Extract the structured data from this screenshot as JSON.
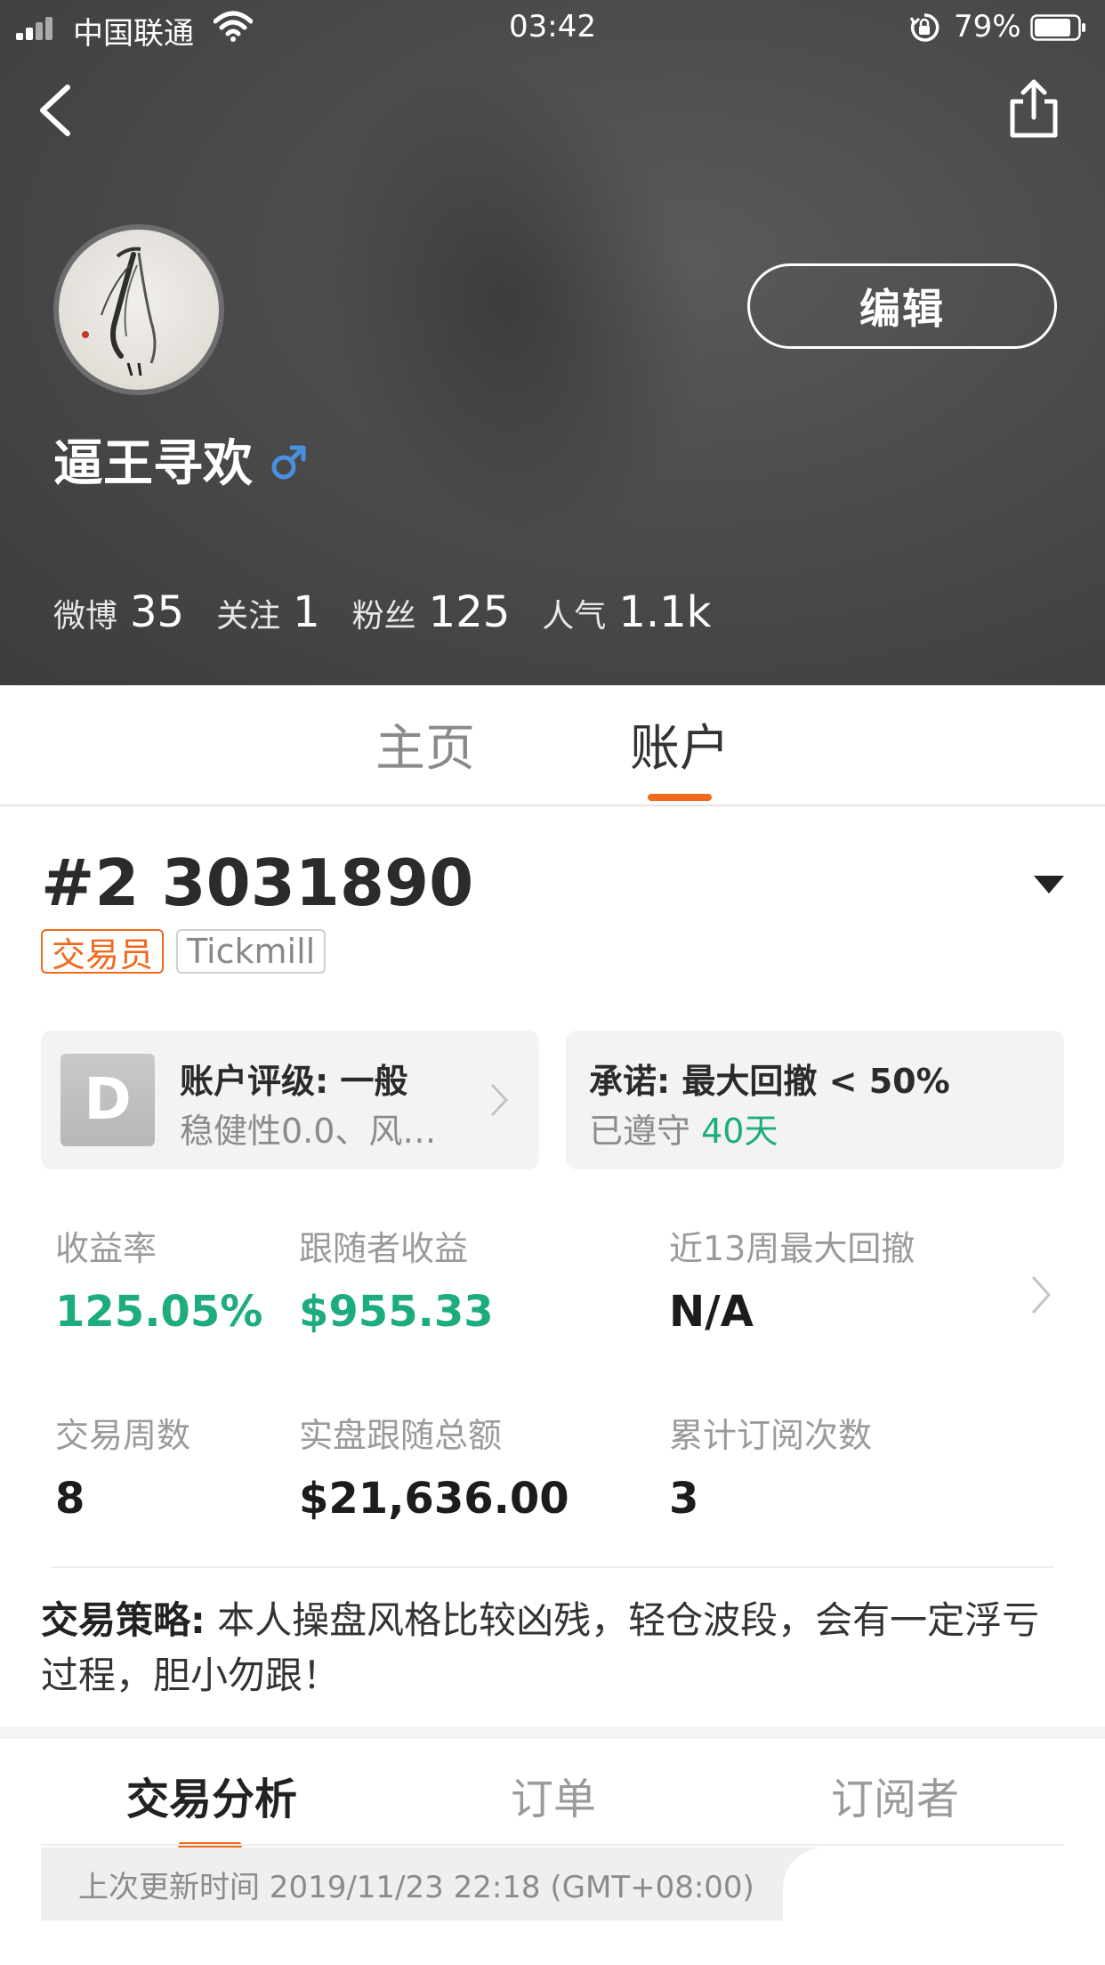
{
  "status_bar": {
    "carrier": "中国联通",
    "time": "03:42",
    "battery": "79%"
  },
  "profile": {
    "name": "逼王寻欢",
    "edit_label": "编辑",
    "stats": [
      {
        "label": "微博",
        "value": "35"
      },
      {
        "label": "关注",
        "value": "1"
      },
      {
        "label": "粉丝",
        "value": "125"
      },
      {
        "label": "人气",
        "value": "1.1k"
      }
    ]
  },
  "tabs": [
    {
      "label": "主页",
      "active": false
    },
    {
      "label": "账户",
      "active": true
    }
  ],
  "account": {
    "title": "#2 3031890",
    "badges": {
      "role": "交易员",
      "broker": "Tickmill"
    },
    "rating": {
      "letter": "D",
      "title": "账户评级: 一般",
      "subtitle": "稳健性0.0、风…"
    },
    "promise": {
      "title": "承诺: 最大回撤 < 50%",
      "subtitle_prefix": "已遵守",
      "subtitle_days": "40天"
    },
    "metrics": [
      {
        "label": "收益率",
        "value": "125.05%"
      },
      {
        "label": "跟随者收益",
        "value": "$955.33"
      },
      {
        "label": "近13周最大回撤",
        "value": "N/A"
      },
      {
        "label": "交易周数",
        "value": "8"
      },
      {
        "label": "实盘跟随总额",
        "value": "$21,636.00"
      },
      {
        "label": "累计订阅次数",
        "value": "3"
      }
    ],
    "strategy": {
      "label": "交易策略:",
      "text": " 本人操盘风格比较凶残，轻仓波段，会有一定浮亏过程，胆小勿跟！"
    }
  },
  "sub_tabs": [
    {
      "label": "交易分析",
      "active": true
    },
    {
      "label": "订单",
      "active": false
    },
    {
      "label": "订阅者",
      "active": false
    }
  ],
  "update_info": "上次更新时间 2019/11/23 22:18 (GMT+08:00)",
  "colors": {
    "accent": "#f06a1d",
    "positive": "#1dab80",
    "header_bg": "#4a4a4a",
    "gender_icon": "#4a90e2"
  },
  "icons": [
    "back-icon",
    "share-icon",
    "gender-male-icon",
    "chevron-right-icon",
    "dropdown-triangle-icon",
    "wifi-icon",
    "signal-icon",
    "battery-icon",
    "rotation-lock-icon"
  ]
}
